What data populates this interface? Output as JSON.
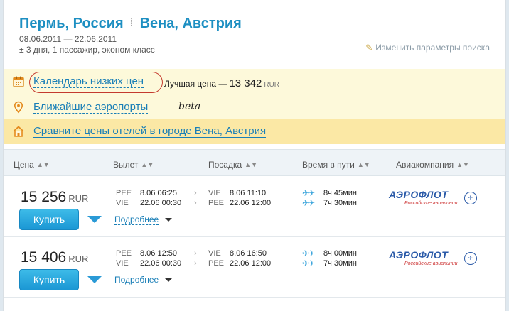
{
  "header": {
    "origin": "Пермь, Россия",
    "destination": "Вена, Австрия",
    "route_separator": "⦚",
    "dates": "08.06.2011 — 22.06.2011",
    "params": "± 3 дня,  1 пассажир,  эконом класс",
    "edit_search": "Изменить параметры поиска"
  },
  "promo": {
    "calendar_link": "Календарь низких цен",
    "best_price_label": "Лучшая цена —",
    "best_price_value": "13 342",
    "best_price_currency": "RUR",
    "airports_link": "Ближайшие аэропорты",
    "beta": "beta",
    "hotels_link": "Сравните цены отелей в городе Вена, Австрия"
  },
  "columns": {
    "price": "Цена",
    "departure": "Вылет",
    "arrival": "Посадка",
    "duration": "Время в пути",
    "airline": "Авиакомпания"
  },
  "results": [
    {
      "price": "15 256",
      "currency": "RUR",
      "buy_label": "Купить",
      "details_label": "Подробнее",
      "legs": [
        {
          "from": "PEE",
          "dep": "8.06 06:25",
          "to": "VIE",
          "arr": "8.06 11:10",
          "duration": "8ч 45мин"
        },
        {
          "from": "VIE",
          "dep": "22.06 00:30",
          "to": "PEE",
          "arr": "22.06 12:00",
          "duration": "7ч 30мин"
        }
      ],
      "airline": "АЭРОФЛОТ",
      "airline_sub": "Российские авиалинии"
    },
    {
      "price": "15 406",
      "currency": "RUR",
      "buy_label": "Купить",
      "details_label": "Подробнее",
      "legs": [
        {
          "from": "PEE",
          "dep": "8.06 12:50",
          "to": "VIE",
          "arr": "8.06 16:50",
          "duration": "8ч 00мин"
        },
        {
          "from": "VIE",
          "dep": "22.06 00:30",
          "to": "PEE",
          "arr": "22.06 12:00",
          "duration": "7ч 30мин"
        }
      ],
      "airline": "АЭРОФЛОТ",
      "airline_sub": "Российские авиалинии"
    }
  ],
  "colors": {
    "accent": "#1d8fc2",
    "link": "#1a7fb7",
    "promo_bg": "#fdf9da",
    "hotel_bg": "#fbe8a5",
    "buy_button": "#1b97d4",
    "highlight_circle": "#c43a2e"
  },
  "icons": {
    "calendar": "calendar-icon",
    "location": "location-pin-icon",
    "hotel": "house-icon",
    "plane": "airplane-icon",
    "pencil": "pencil-icon"
  }
}
